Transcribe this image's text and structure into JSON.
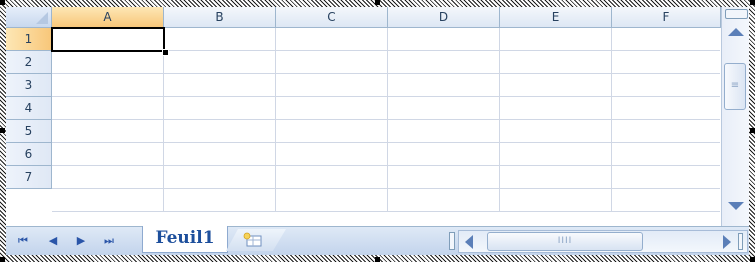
{
  "columns": [
    "A",
    "B",
    "C",
    "D",
    "E",
    "F"
  ],
  "rows": [
    "1",
    "2",
    "3",
    "4",
    "5",
    "6",
    "7"
  ],
  "active_cell": {
    "column": "A",
    "row": "1"
  },
  "sheet_tabs": [
    {
      "label": "Feuil1",
      "active": true
    }
  ],
  "navigation": {
    "first_sheet": "⏮",
    "prev_sheet": "◀",
    "next_sheet": "▶",
    "last_sheet": "⏭"
  },
  "scrollbar_grip": "≡",
  "hscrollbar_grip": "IIII",
  "icons": {
    "insert_sheet": "insert-worksheet-icon",
    "scroll_up": "arrow-up-icon",
    "scroll_down": "arrow-down-icon",
    "scroll_left": "arrow-left-icon",
    "scroll_right": "arrow-right-icon"
  },
  "colors": {
    "header_bg": "#dde7f4",
    "selected_header": "#f8c77a",
    "gridline": "#d0d7e5",
    "tab_text": "#1d4f9c",
    "scroll_arrow": "#5b7fb8"
  }
}
